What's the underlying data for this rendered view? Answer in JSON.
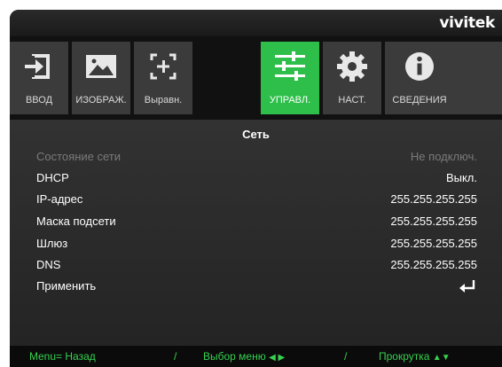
{
  "brand": {
    "logo": "vivitek"
  },
  "tabs": [
    {
      "label": "ВВОД",
      "icon": "input-icon",
      "active": false
    },
    {
      "label": "ИЗОБРАЖ.",
      "icon": "image-icon",
      "active": false
    },
    {
      "label": "Выравн.",
      "icon": "alignment-icon",
      "active": false
    },
    {
      "label": "УПРАВЛ.",
      "icon": "sliders-icon",
      "active": true
    },
    {
      "label": "НАСТ.",
      "icon": "gear-icon",
      "active": false
    },
    {
      "label": "СВЕДЕНИЯ",
      "icon": "info-icon",
      "active": false
    }
  ],
  "panel": {
    "title": "Сеть",
    "rows": [
      {
        "label": "Состояние сети",
        "value": "Не подключ.",
        "disabled": true
      },
      {
        "label": "DHCP",
        "value": "Выкл."
      },
      {
        "label": "IP-адрес",
        "value": "255.255.255.255"
      },
      {
        "label": "Маска подсети",
        "value": "255.255.255.255"
      },
      {
        "label": "Шлюз",
        "value": "255.255.255.255"
      },
      {
        "label": "DNS",
        "value": "255.255.255.255"
      },
      {
        "label": "Применить",
        "icon": "enter-icon"
      }
    ]
  },
  "footer": {
    "back": "Menu= Назад",
    "separator": "/",
    "menu_select": "Выбор меню",
    "scroll": "Прокрутка"
  },
  "colors": {
    "accent": "#2dbf4a",
    "hint_text": "#36d14f",
    "tab_bg": "#3b3b3b",
    "disabled_text": "#7a7a7a"
  }
}
